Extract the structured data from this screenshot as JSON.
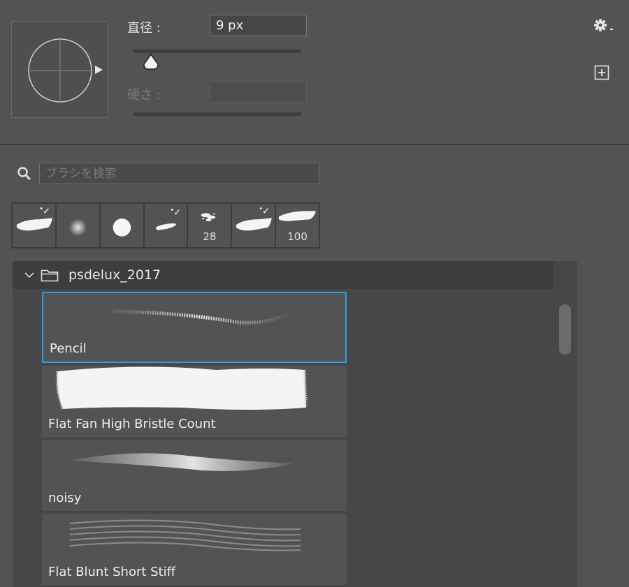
{
  "brush_settings": {
    "size_label": "直径 :",
    "size_value": "9 px",
    "size_fraction": 0.06,
    "hardness_label": "硬さ :",
    "hardness_value": ""
  },
  "search": {
    "placeholder": "ブラシを検索"
  },
  "recent_brushes": [
    {
      "icon": "flat-stroke-icon",
      "count": ""
    },
    {
      "icon": "soft-round-icon",
      "count": ""
    },
    {
      "icon": "hard-round-icon",
      "count": ""
    },
    {
      "icon": "small-stroke-icon",
      "count": ""
    },
    {
      "icon": "scatter-brush-icon",
      "count": "28"
    },
    {
      "icon": "flat-stroke-icon",
      "count": ""
    },
    {
      "icon": "wide-stroke-icon",
      "count": "100"
    }
  ],
  "brush_group": {
    "name": "psdelux_2017",
    "brushes": [
      {
        "name": "Pencil",
        "selected": true
      },
      {
        "name": "Flat Fan High Bristle Count",
        "selected": false
      },
      {
        "name": "noisy",
        "selected": false
      },
      {
        "name": "Flat Blunt Short Stiff",
        "selected": false
      }
    ]
  },
  "colors": {
    "panel_bg": "#535353",
    "selection_border": "#2e9be6"
  }
}
